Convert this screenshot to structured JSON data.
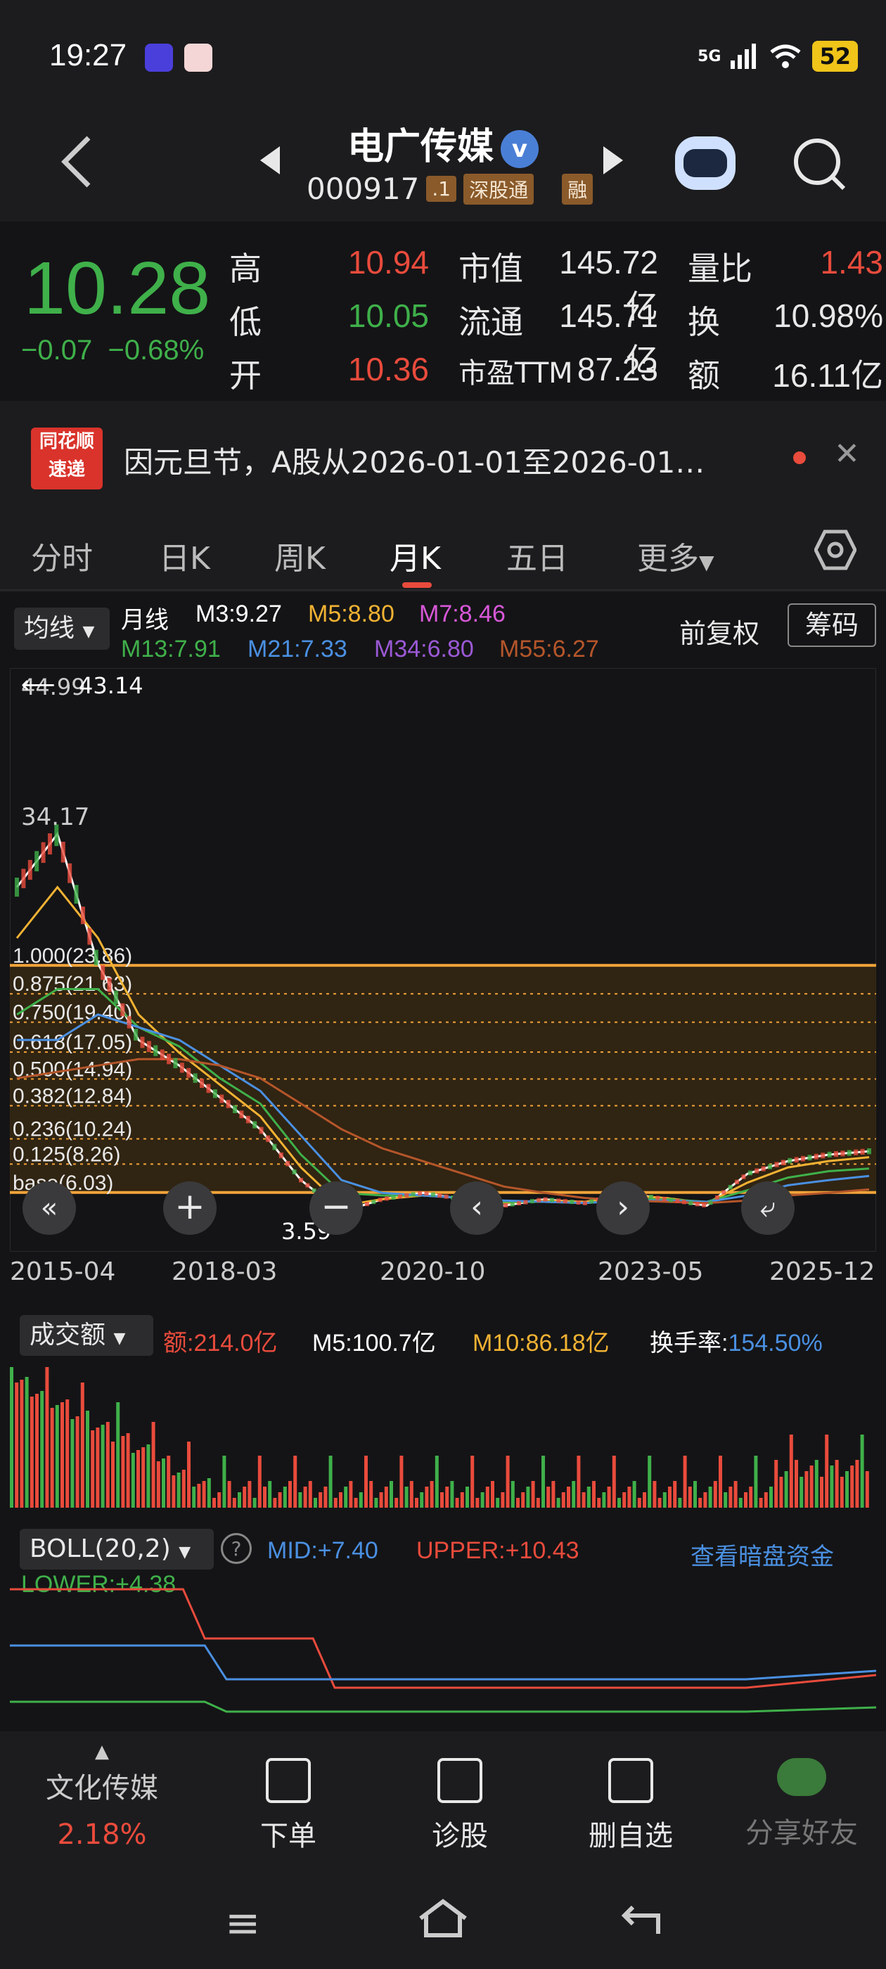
{
  "status": {
    "time": "19:27",
    "network": "5G",
    "battery": "52"
  },
  "nav": {
    "stock_name": "电广传媒",
    "stock_code": "000917",
    "tag1": ".1",
    "tag2": "深股通",
    "tag3": "融"
  },
  "quote": {
    "price": "10.28",
    "change": "−0.07",
    "change_pct": "−0.68%",
    "high_label": "高",
    "high": "10.94",
    "low_label": "低",
    "low": "10.05",
    "open_label": "开",
    "open": "10.36",
    "mcap_label": "市值",
    "mcap": "145.72亿",
    "float_label": "流通",
    "float": "145.71亿",
    "pe_label": "市盈TTM",
    "pe": "87.23",
    "vr_label": "量比",
    "vr": "1.43",
    "turn_label": "换",
    "turn": "10.98%",
    "amt_label": "额",
    "amt": "16.11亿"
  },
  "news": {
    "logo_line1": "同花顺",
    "logo_line2": "速递",
    "text": "因元旦节，A股从2026-01-01至2026-01…"
  },
  "tabs": [
    {
      "label": "分时"
    },
    {
      "label": "日K"
    },
    {
      "label": "周K"
    },
    {
      "label": "月K"
    },
    {
      "label": "五日"
    },
    {
      "label": "更多"
    }
  ],
  "chart_header": {
    "ma_select": "均线",
    "period": "月线",
    "m3": "M3:9.27",
    "m5": "M5:8.80",
    "m7": "M7:8.46",
    "m13": "M13:7.91",
    "m21": "M21:7.33",
    "m34": "M34:6.80",
    "m55": "M55:6.27",
    "fq": "前复权",
    "chip_btn": "筹码"
  },
  "colors": {
    "m3": "#ffffff",
    "m5": "#f2b233",
    "m7": "#d858d8",
    "m13": "#3fb04a",
    "m21": "#4a90e2",
    "m34": "#9b59d6",
    "m55": "#b5562a",
    "fib": "#f2a43a"
  },
  "fib_levels": [
    {
      "label": "1.000(23.86)",
      "value": 23.86
    },
    {
      "label": "0.875(21.63)",
      "value": 21.63
    },
    {
      "label": "0.750(19.40)",
      "value": 19.4
    },
    {
      "label": "0.618(17.05)",
      "value": 17.05
    },
    {
      "label": "0.500(14.94)",
      "value": 14.94
    },
    {
      "label": "0.382(12.84)",
      "value": 12.84
    },
    {
      "label": "0.236(10.24)",
      "value": 10.24
    },
    {
      "label": "0.125(8.26)",
      "value": 8.26
    },
    {
      "label": "base(6.03)",
      "value": 6.03
    }
  ],
  "chart_labels": {
    "top_price": "44.99",
    "max_marker": "43.14",
    "mid_price": "34.17",
    "min_price": "3.59",
    "dates": [
      "2015-04",
      "2018-03",
      "2020-10",
      "2023-05",
      "2025-12"
    ]
  },
  "chart_data": {
    "type": "line",
    "x": [
      "2015-04",
      "2015-06",
      "2015-09",
      "2016-01",
      "2016-06",
      "2017-01",
      "2017-06",
      "2018-03",
      "2018-10",
      "2019-04",
      "2019-12",
      "2020-10",
      "2021-06",
      "2022-02",
      "2022-10",
      "2023-05",
      "2023-12",
      "2024-06",
      "2024-10",
      "2025-03",
      "2025-08",
      "2025-12"
    ],
    "series": [
      {
        "name": "M3",
        "values": [
          30.0,
          34.17,
          24.0,
          18.0,
          16.0,
          13.5,
          11.0,
          7.0,
          4.5,
          5.5,
          6.0,
          5.5,
          5.0,
          5.5,
          5.2,
          6.0,
          5.5,
          5.0,
          7.5,
          8.5,
          9.0,
          9.27
        ]
      },
      {
        "name": "M5",
        "values": [
          26.0,
          30.0,
          26.0,
          20.0,
          17.0,
          14.5,
          12.0,
          8.0,
          5.0,
          5.5,
          5.8,
          5.6,
          5.2,
          5.4,
          5.3,
          5.8,
          5.6,
          5.2,
          6.8,
          8.0,
          8.5,
          8.8
        ]
      },
      {
        "name": "M13",
        "values": [
          20.0,
          22.0,
          22.0,
          19.0,
          17.5,
          15.0,
          13.0,
          9.0,
          6.0,
          5.8,
          5.8,
          5.6,
          5.3,
          5.3,
          5.2,
          5.5,
          5.5,
          5.3,
          6.2,
          7.2,
          7.7,
          7.91
        ]
      },
      {
        "name": "M21",
        "values": [
          18.0,
          18.0,
          20.0,
          19.0,
          18.0,
          16.0,
          14.0,
          10.5,
          7.0,
          6.0,
          5.8,
          5.6,
          5.4,
          5.3,
          5.2,
          5.4,
          5.4,
          5.3,
          5.8,
          6.6,
          7.0,
          7.33
        ]
      },
      {
        "name": "M55",
        "values": [
          15.0,
          15.5,
          16.0,
          16.5,
          16.5,
          16.0,
          15.0,
          13.0,
          11.0,
          9.5,
          8.5,
          7.5,
          6.5,
          6.0,
          5.6,
          5.4,
          5.3,
          5.2,
          5.4,
          5.8,
          6.0,
          6.27
        ]
      }
    ],
    "ylim": [
      3.59,
      44.99
    ]
  },
  "volume_panel": {
    "select": "成交额",
    "amt": "额:214.0亿",
    "m5": "M5:100.7亿",
    "m10": "M10:86.18亿",
    "turn_label": "换手率:",
    "turn": "154.50%"
  },
  "boll_panel": {
    "select": "BOLL(20,2)",
    "mid": "MID:+7.40",
    "upper": "UPPER:+10.43",
    "lower": "LOWER:+4.38",
    "link": "查看暗盘资金"
  },
  "bottom_bar": {
    "sector": "文化传媒",
    "sector_pct": "2.18%",
    "order": "下单",
    "diagnose": "诊股",
    "remove": "删自选",
    "share": "分享好友"
  }
}
